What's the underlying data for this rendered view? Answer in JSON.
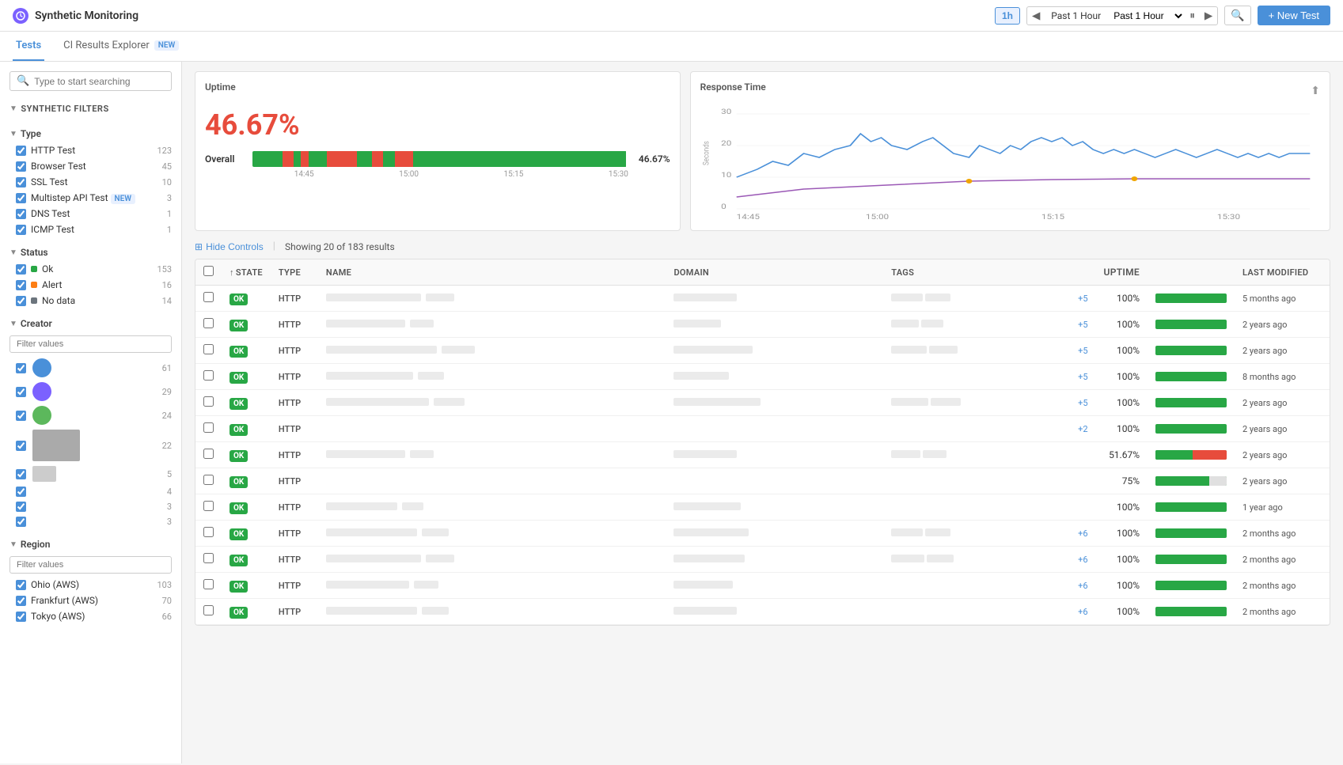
{
  "header": {
    "logo_icon": "synthetic-icon",
    "title": "Synthetic Monitoring",
    "time_button": "1h",
    "time_range": "Past 1 Hour",
    "pause_icon": "pause-icon",
    "rewind_icon": "rewind-icon",
    "forward_icon": "forward-icon",
    "zoom_icon": "zoom-icon",
    "new_test_label": "+ New Test"
  },
  "nav": {
    "tabs": [
      {
        "label": "Tests",
        "active": true,
        "badge": null
      },
      {
        "label": "CI Results Explorer",
        "active": false,
        "badge": "NEW"
      }
    ]
  },
  "sidebar": {
    "search_placeholder": "Type to start searching",
    "filters_label": "SYNTHETIC FILTERS",
    "type_label": "Type",
    "type_items": [
      {
        "label": "HTTP Test",
        "count": 123,
        "checked": true
      },
      {
        "label": "Browser Test",
        "count": 45,
        "checked": true
      },
      {
        "label": "SSL Test",
        "count": 10,
        "checked": true
      },
      {
        "label": "Multistep API Test",
        "count": 3,
        "checked": true,
        "badge": "NEW"
      },
      {
        "label": "DNS Test",
        "count": 1,
        "checked": true
      },
      {
        "label": "ICMP Test",
        "count": 1,
        "checked": true
      }
    ],
    "status_label": "Status",
    "status_items": [
      {
        "label": "Ok",
        "count": 153,
        "checked": true,
        "type": "ok"
      },
      {
        "label": "Alert",
        "count": 16,
        "checked": true,
        "type": "alert"
      },
      {
        "label": "No data",
        "count": 14,
        "checked": true,
        "type": "nodata"
      }
    ],
    "creator_label": "Creator",
    "creator_search_placeholder": "Filter values",
    "creator_items": [
      {
        "count": 61
      },
      {
        "count": 29
      },
      {
        "count": 24
      },
      {
        "count": 22
      },
      {
        "count": 5
      },
      {
        "count": 4
      },
      {
        "count": 3
      },
      {
        "count": 3
      }
    ],
    "region_label": "Region",
    "region_search_placeholder": "Filter values",
    "region_items": [
      {
        "label": "Ohio (AWS)",
        "count": 103,
        "checked": true
      },
      {
        "label": "Frankfurt (AWS)",
        "count": 70,
        "checked": true
      },
      {
        "label": "Tokyo (AWS)",
        "count": 66,
        "checked": true
      }
    ]
  },
  "uptime": {
    "title": "Uptime",
    "percent": "46.67%",
    "overall_label": "Overall",
    "overall_percent": "46.67%",
    "times": [
      "14:45",
      "15:00",
      "15:15",
      "15:30"
    ]
  },
  "response_time": {
    "title": "Response Time",
    "y_labels": [
      "30",
      "20",
      "10",
      "0"
    ],
    "x_labels": [
      "14:45",
      "15:00",
      "15:15",
      "15:30"
    ],
    "y_axis_label": "Seconds"
  },
  "results": {
    "hide_controls_label": "Hide Controls",
    "count_label": "Showing 20 of 183 results",
    "table": {
      "columns": [
        "STATE",
        "TYPE",
        "NAME",
        "DOMAIN",
        "TAGS",
        "",
        "UPTIME",
        "LAST MODIFIED"
      ],
      "rows": [
        {
          "state": "OK",
          "type": "HTTP",
          "name_w": 120,
          "domain_w": 80,
          "tags_w": 80,
          "plus": "+5",
          "uptime": "100%",
          "bar_green": 100,
          "bar_red": 0,
          "modified": "5 months ago"
        },
        {
          "state": "OK",
          "type": "HTTP",
          "name_w": 100,
          "domain_w": 60,
          "tags_w": 70,
          "plus": "+5",
          "uptime": "100%",
          "bar_green": 100,
          "bar_red": 0,
          "modified": "2 years ago"
        },
        {
          "state": "OK",
          "type": "HTTP",
          "name_w": 140,
          "domain_w": 100,
          "tags_w": 90,
          "plus": "+5",
          "uptime": "100%",
          "bar_green": 100,
          "bar_red": 0,
          "modified": "2 years ago"
        },
        {
          "state": "OK",
          "type": "HTTP",
          "name_w": 110,
          "domain_w": 70,
          "tags_w": 0,
          "plus": "+5",
          "uptime": "100%",
          "bar_green": 100,
          "bar_red": 0,
          "modified": "8 months ago"
        },
        {
          "state": "OK",
          "type": "HTTP",
          "name_w": 130,
          "domain_w": 110,
          "tags_w": 95,
          "plus": "+5",
          "uptime": "100%",
          "bar_green": 100,
          "bar_red": 0,
          "modified": "2 years ago"
        },
        {
          "state": "OK",
          "type": "HTTP",
          "name_w": 0,
          "domain_w": 0,
          "tags_w": 0,
          "plus": "+2",
          "uptime": "100%",
          "bar_green": 100,
          "bar_red": 0,
          "modified": "2 years ago"
        },
        {
          "state": "OK",
          "type": "HTTP",
          "name_w": 100,
          "domain_w": 80,
          "tags_w": 75,
          "plus": "",
          "uptime": "51.67%",
          "bar_green": 52,
          "bar_red": 48,
          "modified": "2 years ago"
        },
        {
          "state": "OK",
          "type": "HTTP",
          "name_w": 0,
          "domain_w": 0,
          "tags_w": 0,
          "plus": "",
          "uptime": "75%",
          "bar_green": 75,
          "bar_red": 0,
          "modified": "2 years ago"
        },
        {
          "state": "OK",
          "type": "HTTP",
          "name_w": 90,
          "domain_w": 85,
          "tags_w": 0,
          "plus": "",
          "uptime": "100%",
          "bar_green": 100,
          "bar_red": 0,
          "modified": "1 year ago"
        },
        {
          "state": "OK",
          "type": "HTTP",
          "name_w": 115,
          "domain_w": 95,
          "tags_w": 80,
          "plus": "+6",
          "uptime": "100%",
          "bar_green": 100,
          "bar_red": 0,
          "modified": "2 months ago"
        },
        {
          "state": "OK",
          "type": "HTTP",
          "name_w": 120,
          "domain_w": 90,
          "tags_w": 85,
          "plus": "+6",
          "uptime": "100%",
          "bar_green": 100,
          "bar_red": 0,
          "modified": "2 months ago"
        },
        {
          "state": "OK",
          "type": "HTTP",
          "name_w": 105,
          "domain_w": 75,
          "tags_w": 0,
          "plus": "+6",
          "uptime": "100%",
          "bar_green": 100,
          "bar_red": 0,
          "modified": "2 months ago"
        },
        {
          "state": "OK",
          "type": "HTTP",
          "name_w": 115,
          "domain_w": 80,
          "tags_w": 0,
          "plus": "+6",
          "uptime": "100%",
          "bar_green": 100,
          "bar_red": 0,
          "modified": "2 months ago"
        }
      ]
    }
  }
}
